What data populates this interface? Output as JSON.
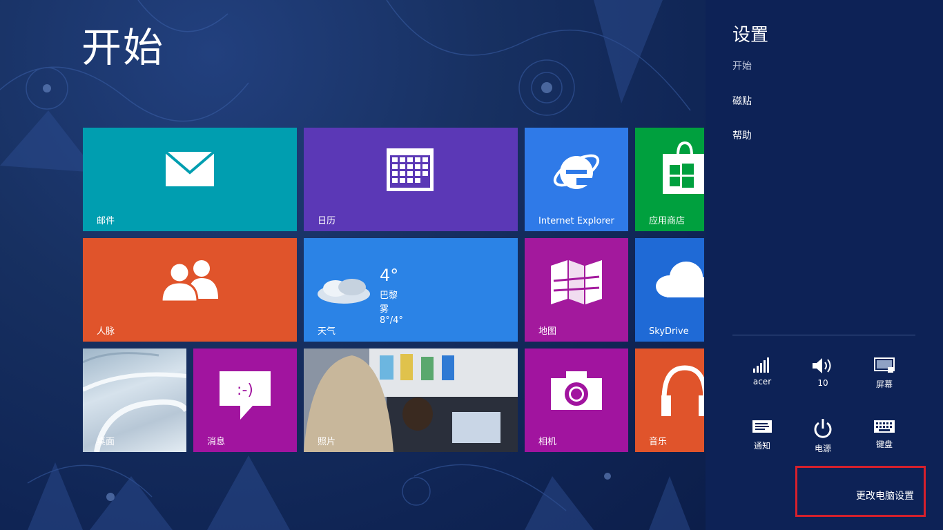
{
  "start": {
    "title": "开始"
  },
  "tiles": {
    "mail": "邮件",
    "calendar": "日历",
    "ie": "Internet Explorer",
    "store": "应用商店",
    "people": "人脉",
    "weather": {
      "label": "天气",
      "temp": "4°",
      "city": "巴黎",
      "condition": "雾",
      "range": "8°/4°"
    },
    "maps": "地图",
    "skydrive": "SkyDrive",
    "desktop": "桌面",
    "messaging": "消息",
    "photos": "照片",
    "camera": "相机",
    "music": "音乐"
  },
  "settings": {
    "title": "设置",
    "subtitle": "开始",
    "links": [
      "磁贴",
      "帮助"
    ],
    "quick": {
      "network": "acer",
      "volume": "10",
      "screen": "屏幕",
      "notifications": "通知",
      "power": "电源",
      "keyboard": "键盘"
    },
    "change_pc_settings": "更改电脑设置"
  },
  "colors": {
    "mail": "#009eb0",
    "calendar": "#5b38b6",
    "ie": "#2f7ae8",
    "store": "#00a03e",
    "people": "#e0542b",
    "weather": "#2b83e6",
    "maps": "#a3199d",
    "skydrive": "#1f6ad6",
    "messaging": "#a1149f",
    "camera": "#a1149f",
    "music": "#e0542b",
    "highlight": "#d6202c"
  },
  "icons": [
    "mail-icon",
    "calendar-icon",
    "ie-icon",
    "store-icon",
    "people-icon",
    "cloud-icon",
    "maps-icon",
    "skydrive-icon",
    "message-icon",
    "camera-icon",
    "headphones-icon",
    "signal-icon",
    "volume-icon",
    "screen-icon",
    "notification-icon",
    "power-icon",
    "keyboard-icon"
  ]
}
